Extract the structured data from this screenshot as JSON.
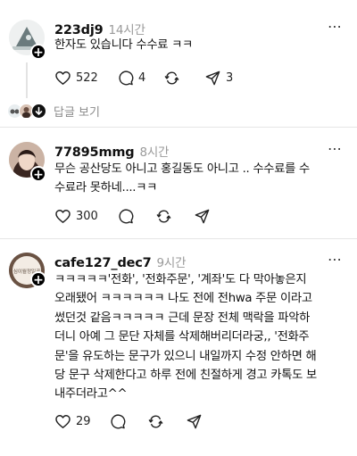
{
  "posts": [
    {
      "username": "223dj9",
      "time": "14시간",
      "text": "한자도 있습니다 수수료 ㅋㅋ",
      "likes": "522",
      "comments": "4",
      "shares": "3",
      "replies_label": "답글 보기"
    },
    {
      "username": "77895mmg",
      "time": "8시간",
      "text": "무슨 공산당도 아니고 홍길동도 아니고 .. 수수료를 수\n수료라 못하네....ㅋㅋ",
      "likes": "300"
    },
    {
      "username": "cafe127_dec7",
      "time": "9시간",
      "avatar_text": "심이월정일곱",
      "text": "ㅋㅋㅋㅋㅋ'전화', '전화주문', '계좌'도 다 막아놓은지\n오래됐어 ㅋㅋㅋㅋㅋㅋ 나도 전에 전hwa 주문 이라고\n썼던것 같음ㅋㅋㅋㅋㅋ 근데 문장 전체 맥락을 파악하\n더니 아예 그 문단 자체를 삭제해버리더라궁,, '전화주\n문'을 유도하는 문구가 있으니 내일까지 수정 안하면 해\n당 문구 삭제한다고 하루 전에 친절하게 경고 카톡도 보\n내주더라고^^",
      "likes": "29"
    }
  ],
  "more_icon": "⋯",
  "colors": {
    "text": "#111111",
    "muted": "#9a9a9a",
    "divider": "#e6e6e6"
  }
}
